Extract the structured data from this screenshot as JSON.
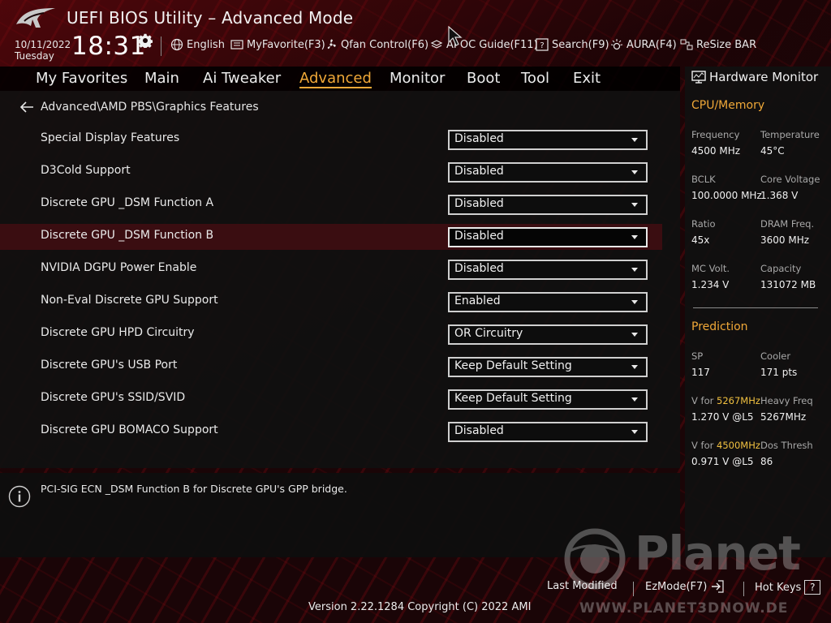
{
  "header": {
    "title": "UEFI BIOS Utility – Advanced Mode",
    "date": "10/11/2022",
    "weekday": "Tuesday",
    "time": "18:31",
    "tools": [
      {
        "label": "English",
        "icon": "globe-icon"
      },
      {
        "label": "MyFavorite(F3)",
        "icon": "favorite-icon"
      },
      {
        "label": "Qfan Control(F6)",
        "icon": "fan-icon"
      },
      {
        "label": "AI OC Guide(F11)",
        "icon": "ai-oc-icon"
      },
      {
        "label": "Search(F9)",
        "icon": "search-help-icon"
      },
      {
        "label": "AURA(F4)",
        "icon": "aura-icon"
      },
      {
        "label": "ReSize BAR",
        "icon": "resize-bar-icon"
      }
    ]
  },
  "menu": {
    "items": [
      "My Favorites",
      "Main",
      "Ai Tweaker",
      "Advanced",
      "Monitor",
      "Boot",
      "Tool",
      "Exit"
    ],
    "active": "Advanced"
  },
  "breadcrumb": "Advanced\\AMD PBS\\Graphics Features",
  "settings": [
    {
      "label": "Special Display Features",
      "value": "Disabled"
    },
    {
      "label": "D3Cold Support",
      "value": "Disabled"
    },
    {
      "label": "Discrete GPU _DSM Function A",
      "value": "Disabled"
    },
    {
      "label": "Discrete GPU _DSM Function B",
      "value": "Disabled",
      "selected": true
    },
    {
      "label": "NVIDIA DGPU Power Enable",
      "value": "Disabled"
    },
    {
      "label": "Non-Eval Discrete GPU Support",
      "value": "Enabled"
    },
    {
      "label": "Discrete GPU HPD Circuitry",
      "value": "OR Circuitry"
    },
    {
      "label": "Discrete GPU's USB Port",
      "value": "Keep Default Setting"
    },
    {
      "label": "Discrete GPU's SSID/SVID",
      "value": "Keep Default Setting"
    },
    {
      "label": "Discrete GPU BOMACO Support",
      "value": "Disabled"
    }
  ],
  "help_text": "PCI-SIG ECN _DSM Function B for Discrete GPU's GPP bridge.",
  "hardware_monitor": {
    "title": "Hardware Monitor",
    "cpu_memory_title": "CPU/Memory",
    "cpu_memory": [
      {
        "label": "Frequency",
        "value": "4500 MHz"
      },
      {
        "label": "Temperature",
        "value": "45°C"
      },
      {
        "label": "BCLK",
        "value": "100.0000 MHz"
      },
      {
        "label": "Core Voltage",
        "value": "1.368 V"
      },
      {
        "label": "Ratio",
        "value": "45x"
      },
      {
        "label": "DRAM Freq.",
        "value": "3600 MHz"
      },
      {
        "label": "MC Volt.",
        "value": "1.234 V"
      },
      {
        "label": "Capacity",
        "value": "131072 MB"
      }
    ],
    "prediction_title": "Prediction",
    "prediction": {
      "sp_label": "SP",
      "sp_value": "117",
      "cooler_label": "Cooler",
      "cooler_value": "171 pts",
      "v1_prefix": "V for ",
      "v1_freq": "5267MHz",
      "v1_value": "1.270 V @L5",
      "heavy_label": "Heavy Freq",
      "heavy_value": "5267MHz",
      "v2_prefix": "V for ",
      "v2_freq": "4500MHz",
      "v2_value": "0.971 V @L5",
      "dos_label": "Dos Thresh",
      "dos_value": "86"
    }
  },
  "footer": {
    "last_modified": "Last Modified",
    "ezmode": "EzMode(F7)",
    "hotkeys": "Hot Keys",
    "hotkeys_key": "?",
    "version": "Version 2.22.1284 Copyright (C) 2022 AMI"
  },
  "watermark": {
    "name": "Planet",
    "url": "WWW.PLANET3DNOW.DE"
  },
  "colors": {
    "accent": "#f0a838",
    "selected_row": "#3a0d11",
    "highlight_value": "#f0c040"
  }
}
